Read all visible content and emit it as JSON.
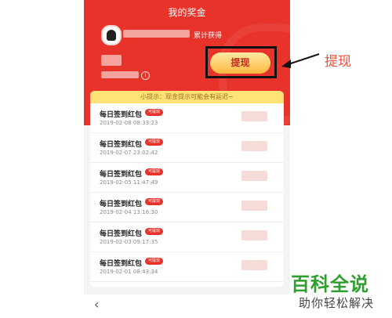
{
  "header": {
    "title": "我的奖金"
  },
  "profile": {
    "earned_label": "累计获得"
  },
  "actions": {
    "withdraw_label": "提现"
  },
  "annotation": {
    "text": "提现"
  },
  "tip": {
    "text": "小提示：现金提示可能会有延迟~"
  },
  "records": [
    {
      "title": "每日签到红包",
      "badge": "可提现",
      "time": "2019-02-08 08:33:23"
    },
    {
      "title": "每日签到红包",
      "badge": "可提现",
      "time": "2019-02-07 23:02:42"
    },
    {
      "title": "每日签到红包",
      "badge": "可提现",
      "time": "2019-02-05 11:47:49"
    },
    {
      "title": "每日签到红包",
      "badge": "可提现",
      "time": "2019-02-04 13:16:30"
    },
    {
      "title": "每日签到红包",
      "badge": "可提现",
      "time": "2019-02-03 09:17:35"
    },
    {
      "title": "每日签到红包",
      "badge": "可提现",
      "time": "2019-02-01 08:43:34"
    }
  ],
  "nav": {
    "back_icon": "chevron-left-icon"
  },
  "watermark": {
    "title": "百科全说",
    "subtitle": "助你轻松解决"
  },
  "colors": {
    "primary_red": "#e8332a",
    "tip_bg": "#ffe377",
    "button_gold": "#fdb840",
    "annotation": "#ef4e3a",
    "watermark_green": "#2e9e2e"
  }
}
